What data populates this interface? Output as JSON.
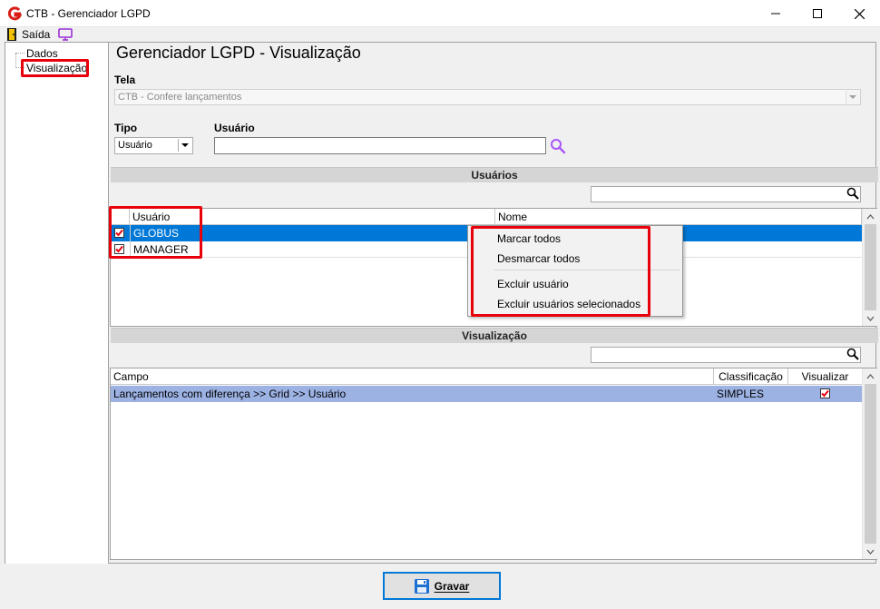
{
  "window": {
    "title": "CTB - Gerenciador LGPD",
    "minimize_symbol": "—",
    "maximize_symbol": "☐",
    "close_symbol": "✕"
  },
  "menubar": {
    "exit_label": "Saída"
  },
  "tree": {
    "items": [
      {
        "label": "Dados"
      },
      {
        "label": "Visualização"
      }
    ]
  },
  "page": {
    "title": "Gerenciador LGPD - Visualização"
  },
  "tela": {
    "label": "Tela",
    "value": "CTB - Confere lançamentos"
  },
  "tipo": {
    "label": "Tipo",
    "value": "Usuário"
  },
  "usuario": {
    "label": "Usuário",
    "value": ""
  },
  "users_section": {
    "title": "Usuários",
    "filter_value": "",
    "columns": [
      "Usuário",
      "Nome"
    ],
    "rows": [
      {
        "user": "GLOBUS",
        "name": "",
        "checked": true,
        "selected": true
      },
      {
        "user": "MANAGER",
        "name": "",
        "checked": true,
        "selected": false
      }
    ]
  },
  "context_menu": {
    "items": [
      "Marcar todos",
      "Desmarcar todos",
      "Excluir usuário",
      "Excluir usuários selecionados"
    ]
  },
  "view_section": {
    "title": "Visualização",
    "filter_value": "",
    "columns": [
      "Campo",
      "Classificação",
      "Visualizar"
    ],
    "rows": [
      {
        "campo": "Lançamentos com diferença >> Grid >> Usuário",
        "classificacao": "SIMPLES",
        "visualizar": true
      }
    ]
  },
  "footer": {
    "save_label_first": "G",
    "save_label_rest": "ravar"
  },
  "colors": {
    "accent": "#0078d7",
    "highlight_red": "#e8000b",
    "row_highlight": "#9cb2e3",
    "search_purple": "#a855f7"
  }
}
